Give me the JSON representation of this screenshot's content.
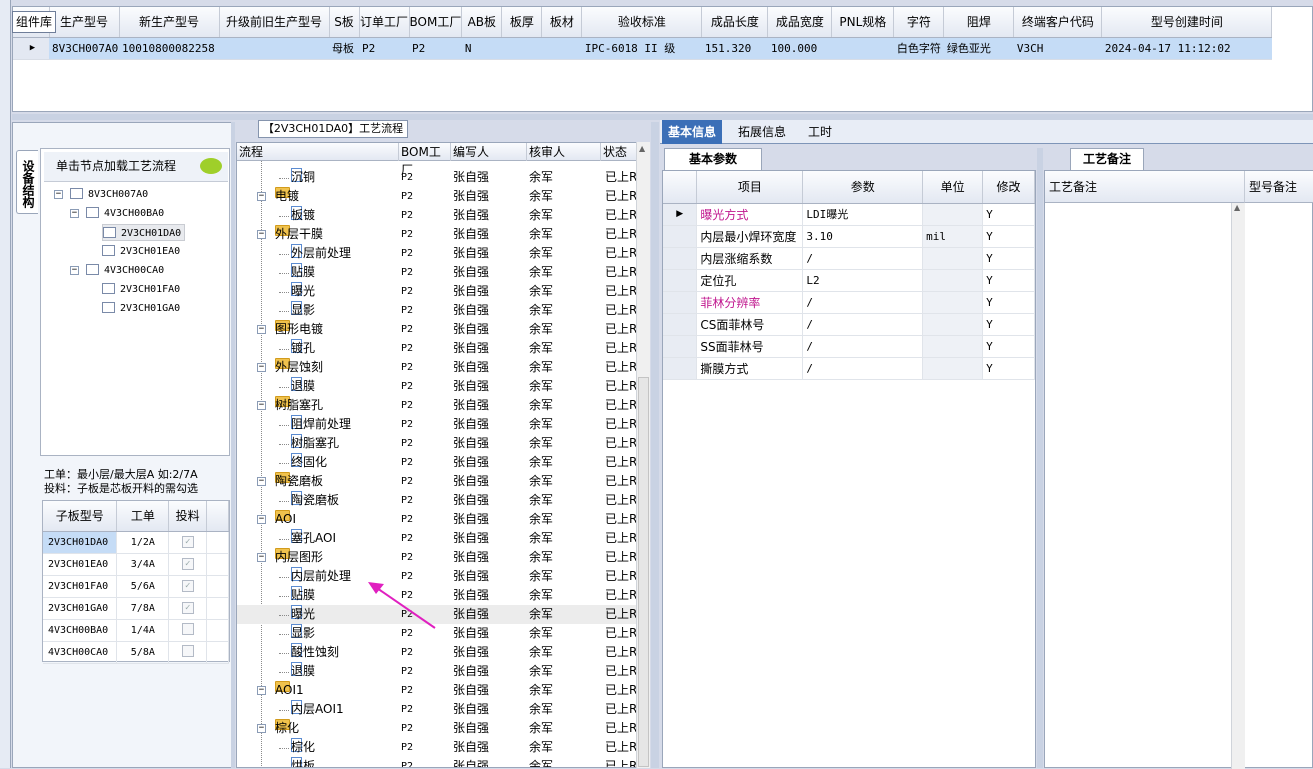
{
  "top_grid": {
    "library_button": "组件库",
    "columns": [
      "生产型号",
      "新生产型号",
      "升级前旧生产型号",
      "S板",
      "订单工厂",
      "BOM工厂",
      "AB板",
      "板厚",
      "板材",
      "验收标准",
      "成品长度",
      "成品宽度",
      "PNL规格",
      "字符",
      "阻焊",
      "终端客户代码",
      "型号创建时间"
    ],
    "row": [
      "8V3CH007A0",
      "10010800082258",
      "",
      "母板",
      "P2",
      "P2",
      "N",
      "",
      "",
      "IPC-6018 II 级",
      "151.320",
      "100.000",
      "",
      "白色字符",
      "绿色亚光",
      "V3CH",
      "2024-04-17 11:12:02"
    ]
  },
  "left_panel": {
    "vertical_tab": "设备结构",
    "tree_header": "单击节点加载工艺流程",
    "tree": [
      {
        "label": "8V3CH007A0",
        "level": 0
      },
      {
        "label": "4V3CH00BA0",
        "level": 1
      },
      {
        "label": "2V3CH01DA0",
        "level": 2,
        "selected": true
      },
      {
        "label": "2V3CH01EA0",
        "level": 2
      },
      {
        "label": "4V3CH00CA0",
        "level": 1
      },
      {
        "label": "2V3CH01FA0",
        "level": 2
      },
      {
        "label": "2V3CH01GA0",
        "level": 2
      }
    ],
    "legend_line1": "工单：最小层/最大层A 如:2/7A",
    "legend_line2": "投料：子板是芯板开料的需勾选",
    "sub_grid": {
      "columns": [
        "子板型号",
        "工单",
        "投料"
      ],
      "rows": [
        {
          "model": "2V3CH01DA0",
          "order": "1/2A",
          "feed": true
        },
        {
          "model": "2V3CH01EA0",
          "order": "3/4A",
          "feed": true
        },
        {
          "model": "2V3CH01FA0",
          "order": "5/6A",
          "feed": true
        },
        {
          "model": "2V3CH01GA0",
          "order": "7/8A",
          "feed": true
        },
        {
          "model": "4V3CH00BA0",
          "order": "1/4A",
          "feed": false
        },
        {
          "model": "4V3CH00CA0",
          "order": "5/8A",
          "feed": false
        }
      ]
    }
  },
  "flow_panel": {
    "title": "【2V3CH01DA0】工艺流程",
    "columns": [
      "流程",
      "BOM工厂",
      "编写人",
      "核审人",
      "状态"
    ],
    "rows": [
      {
        "name": "沉铜",
        "type": "doc",
        "bom": "P2",
        "writer": "张自强",
        "reviewer": "余军",
        "status": "已上R"
      },
      {
        "name": "电镀",
        "type": "folder",
        "bom": "P2",
        "writer": "张自强",
        "reviewer": "余军",
        "status": "已上R"
      },
      {
        "name": "板镀",
        "type": "doc",
        "bom": "P2",
        "writer": "张自强",
        "reviewer": "余军",
        "status": "已上R"
      },
      {
        "name": "外层干膜",
        "type": "folder",
        "bom": "P2",
        "writer": "张自强",
        "reviewer": "余军",
        "status": "已上R"
      },
      {
        "name": "外层前处理",
        "type": "doc",
        "bom": "P2",
        "writer": "张自强",
        "reviewer": "余军",
        "status": "已上R"
      },
      {
        "name": "贴膜",
        "type": "doc",
        "bom": "P2",
        "writer": "张自强",
        "reviewer": "余军",
        "status": "已上R"
      },
      {
        "name": "曝光",
        "type": "doc",
        "bom": "P2",
        "writer": "张自强",
        "reviewer": "余军",
        "status": "已上R"
      },
      {
        "name": "显影",
        "type": "doc",
        "bom": "P2",
        "writer": "张自强",
        "reviewer": "余军",
        "status": "已上R"
      },
      {
        "name": "图形电镀",
        "type": "folder",
        "bom": "P2",
        "writer": "张自强",
        "reviewer": "余军",
        "status": "已上R"
      },
      {
        "name": "镀孔",
        "type": "doc",
        "bom": "P2",
        "writer": "张自强",
        "reviewer": "余军",
        "status": "已上R"
      },
      {
        "name": "外层蚀刻",
        "type": "folder",
        "bom": "P2",
        "writer": "张自强",
        "reviewer": "余军",
        "status": "已上R"
      },
      {
        "name": "退膜",
        "type": "doc",
        "bom": "P2",
        "writer": "张自强",
        "reviewer": "余军",
        "status": "已上R"
      },
      {
        "name": "树脂塞孔",
        "type": "folder",
        "bom": "P2",
        "writer": "张自强",
        "reviewer": "余军",
        "status": "已上R"
      },
      {
        "name": "阻焊前处理",
        "type": "doc",
        "bom": "P2",
        "writer": "张自强",
        "reviewer": "余军",
        "status": "已上R"
      },
      {
        "name": "树脂塞孔",
        "type": "doc",
        "bom": "P2",
        "writer": "张自强",
        "reviewer": "余军",
        "status": "已上R"
      },
      {
        "name": "终固化",
        "type": "doc",
        "bom": "P2",
        "writer": "张自强",
        "reviewer": "余军",
        "status": "已上R"
      },
      {
        "name": "陶瓷磨板",
        "type": "folder",
        "bom": "P2",
        "writer": "张自强",
        "reviewer": "余军",
        "status": "已上R"
      },
      {
        "name": "陶瓷磨板",
        "type": "doc",
        "bom": "P2",
        "writer": "张自强",
        "reviewer": "余军",
        "status": "已上R"
      },
      {
        "name": "AOI",
        "type": "folder",
        "bom": "P2",
        "writer": "张自强",
        "reviewer": "余军",
        "status": "已上R"
      },
      {
        "name": "塞孔AOI",
        "type": "doc",
        "bom": "P2",
        "writer": "张自强",
        "reviewer": "余军",
        "status": "已上R"
      },
      {
        "name": "内层图形",
        "type": "folder",
        "bom": "P2",
        "writer": "张自强",
        "reviewer": "余军",
        "status": "已上R"
      },
      {
        "name": "内层前处理",
        "type": "doc",
        "bom": "P2",
        "writer": "张自强",
        "reviewer": "余军",
        "status": "已上R"
      },
      {
        "name": "贴膜",
        "type": "doc",
        "bom": "P2",
        "writer": "张自强",
        "reviewer": "余军",
        "status": "已上R"
      },
      {
        "name": "曝光",
        "type": "doc",
        "bom": "P2",
        "writer": "张自强",
        "reviewer": "余军",
        "status": "已上R",
        "highlight": true
      },
      {
        "name": "显影",
        "type": "doc",
        "bom": "P2",
        "writer": "张自强",
        "reviewer": "余军",
        "status": "已上R"
      },
      {
        "name": "酸性蚀刻",
        "type": "doc",
        "bom": "P2",
        "writer": "张自强",
        "reviewer": "余军",
        "status": "已上R"
      },
      {
        "name": "退膜",
        "type": "doc",
        "bom": "P2",
        "writer": "张自强",
        "reviewer": "余军",
        "status": "已上R"
      },
      {
        "name": "AOI1",
        "type": "folder",
        "bom": "P2",
        "writer": "张自强",
        "reviewer": "余军",
        "status": "已上R"
      },
      {
        "name": "内层AOI1",
        "type": "doc",
        "bom": "P2",
        "writer": "张自强",
        "reviewer": "余军",
        "status": "已上R"
      },
      {
        "name": "棕化",
        "type": "folder",
        "bom": "P2",
        "writer": "张自强",
        "reviewer": "余军",
        "status": "已上R"
      },
      {
        "name": "棕化",
        "type": "doc",
        "bom": "P2",
        "writer": "张自强",
        "reviewer": "余军",
        "status": "已上R"
      },
      {
        "name": "烘板",
        "type": "doc",
        "bom": "P2",
        "writer": "张自强",
        "reviewer": "余军",
        "status": "已上R"
      }
    ]
  },
  "right_panel": {
    "tabs": [
      "基本信息",
      "拓展信息",
      "工时"
    ],
    "active_tab": 0,
    "param_tab": "基本参数",
    "param_columns": [
      "项目",
      "参数",
      "单位",
      "修改"
    ],
    "params": [
      {
        "item": "曝光方式",
        "value": "LDI曝光",
        "unit": "",
        "edit": "Y",
        "highlight": true
      },
      {
        "item": "内层最小焊环宽度",
        "value": "3.10",
        "unit": "mil",
        "edit": "Y",
        "highlight": false
      },
      {
        "item": "内层涨缩系数",
        "value": "/",
        "unit": "",
        "edit": "Y",
        "highlight": false
      },
      {
        "item": "定位孔",
        "value": "L2",
        "unit": "",
        "edit": "Y",
        "highlight": false
      },
      {
        "item": "菲林分辨率",
        "value": "/",
        "unit": "",
        "edit": "Y",
        "highlight": true
      },
      {
        "item": "CS面菲林号",
        "value": "/",
        "unit": "",
        "edit": "Y",
        "highlight": false
      },
      {
        "item": "SS面菲林号",
        "value": "/",
        "unit": "",
        "edit": "Y",
        "highlight": false
      },
      {
        "item": "撕膜方式",
        "value": "/",
        "unit": "",
        "edit": "Y",
        "highlight": false
      }
    ],
    "note_tab": "工艺备注",
    "note_columns": [
      "工艺备注",
      "型号备注"
    ]
  },
  "colors": {
    "accent_tab": "#3b6fb7",
    "selection_row": "#c5dcf6",
    "highlight_text": "#c0178f",
    "annotation_arrow": "#e020c0"
  }
}
